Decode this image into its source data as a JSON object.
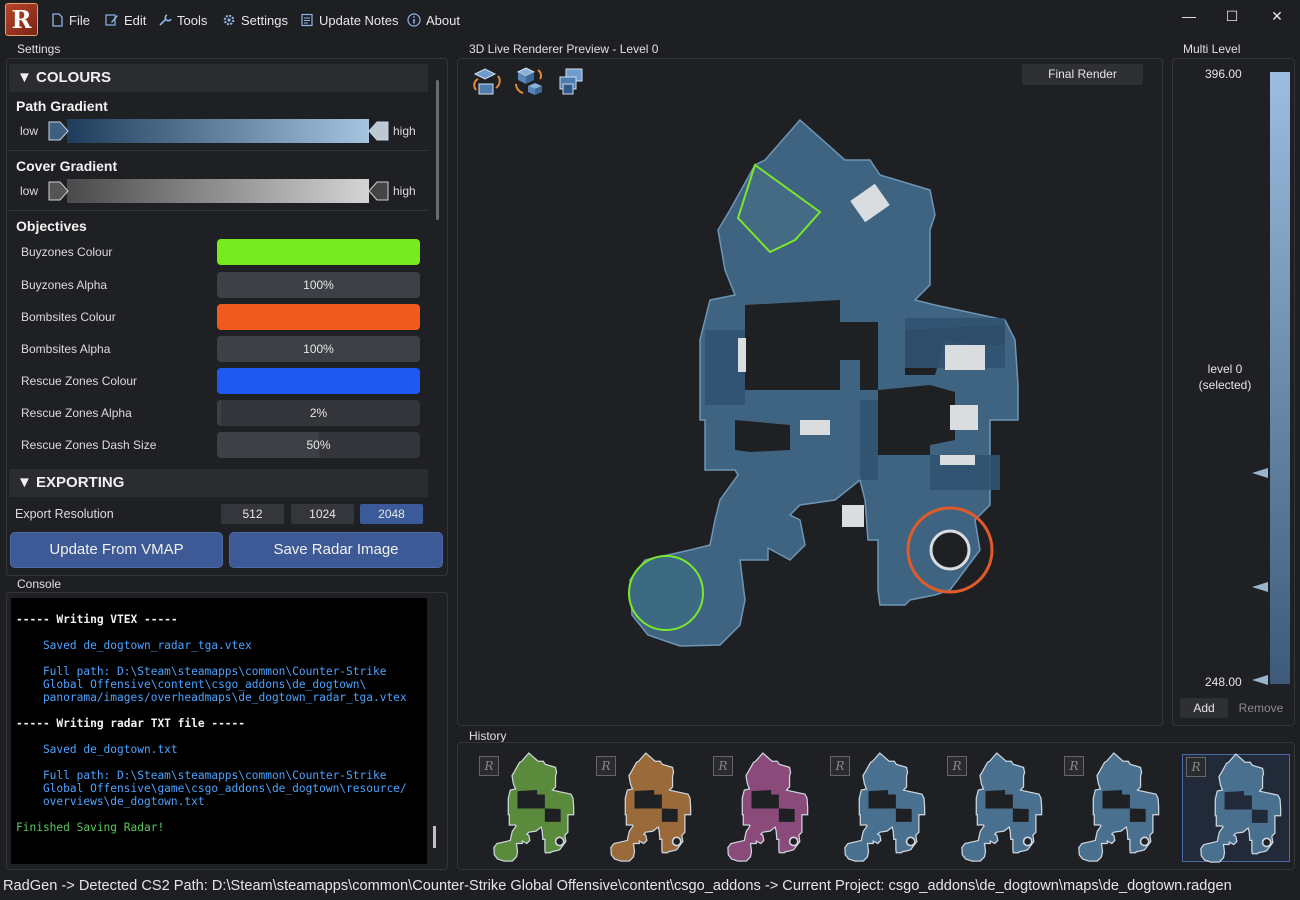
{
  "app": {
    "logo_letter": "R"
  },
  "menu": [
    {
      "label": "File",
      "icon": "file-icon"
    },
    {
      "label": "Edit",
      "icon": "edit-icon"
    },
    {
      "label": "Tools",
      "icon": "tools-icon"
    },
    {
      "label": "Settings",
      "icon": "gear-icon"
    },
    {
      "label": "Update Notes",
      "icon": "notes-icon"
    },
    {
      "label": "About",
      "icon": "info-icon"
    }
  ],
  "window_controls": {
    "minimize": "—",
    "maximize": "☐",
    "close": "✕"
  },
  "settings": {
    "title": "Settings",
    "colours": {
      "header": "▼ COLOURS",
      "path_gradient": {
        "title": "Path Gradient",
        "low": "low",
        "high": "high",
        "from": "#1e3d5c",
        "to": "#a6c4e0"
      },
      "cover_gradient": {
        "title": "Cover Gradient",
        "low": "low",
        "high": "high",
        "from": "#4a4a4a",
        "to": "#d4d4d4"
      },
      "objectives_title": "Objectives",
      "objectives": [
        {
          "label": "Buyzones Colour",
          "type": "color",
          "color": "#76ea1e"
        },
        {
          "label": "Buyzones Alpha",
          "type": "slider",
          "value": "100%",
          "fraction": 1.0
        },
        {
          "label": "Bombsites Colour",
          "type": "color",
          "color": "#f05a1e"
        },
        {
          "label": "Bombsites Alpha",
          "type": "slider",
          "value": "100%",
          "fraction": 1.0
        },
        {
          "label": "Rescue Zones Colour",
          "type": "color",
          "color": "#1e5af0"
        },
        {
          "label": "Rescue Zones Alpha",
          "type": "slider",
          "value": "2%",
          "fraction": 0.02
        },
        {
          "label": "Rescue Zones Dash Size",
          "type": "slider",
          "value": "50%",
          "fraction": 0.5
        }
      ]
    },
    "exporting": {
      "header": "▼ EXPORTING",
      "resolution_label": "Export Resolution",
      "resolutions": [
        "512",
        "1024",
        "2048"
      ],
      "selected_resolution": "2048"
    },
    "update_button": "Update From VMAP",
    "save_button": "Save Radar Image"
  },
  "console": {
    "title": "Console",
    "lines": [
      {
        "text": "----- Writing VTEX -----",
        "style": "white"
      },
      {
        "text": "",
        "style": "gap"
      },
      {
        "text": "    Saved de_dogtown_radar_tga.vtex",
        "style": "blue"
      },
      {
        "text": "",
        "style": "gap"
      },
      {
        "text": "    Full path: D:\\Steam\\steamapps\\common\\Counter-Strike",
        "style": "blue"
      },
      {
        "text": "    Global Offensive\\content\\csgo_addons\\de_dogtown\\",
        "style": "blue"
      },
      {
        "text": "    panorama/images/overheadmaps\\de_dogtown_radar_tga.vtex",
        "style": "blue"
      },
      {
        "text": "",
        "style": "gap"
      },
      {
        "text": "----- Writing radar TXT file -----",
        "style": "white"
      },
      {
        "text": "",
        "style": "gap"
      },
      {
        "text": "    Saved de_dogtown.txt",
        "style": "blue"
      },
      {
        "text": "",
        "style": "gap"
      },
      {
        "text": "    Full path: D:\\Steam\\steamapps\\common\\Counter-Strike",
        "style": "blue"
      },
      {
        "text": "    Global Offensive\\game\\csgo_addons\\de_dogtown\\resource/",
        "style": "blue"
      },
      {
        "text": "    overviews\\de_dogtown.txt",
        "style": "blue"
      },
      {
        "text": "",
        "style": "gap"
      },
      {
        "text": "Finished Saving Radar!",
        "style": "green"
      }
    ]
  },
  "preview": {
    "title": "3D Live Renderer Preview - Level 0",
    "mode_button": "Final Render"
  },
  "multi_level": {
    "title": "Multi Level",
    "top_value": "396.00",
    "bottom_value": "248.00",
    "level_name": "level 0",
    "level_state": "(selected)",
    "add_button": "Add",
    "remove_button": "Remove"
  },
  "history": {
    "title": "History",
    "badge": "R",
    "thumbnails": [
      {
        "color": "#5a8a3c",
        "selected": false
      },
      {
        "color": "#9a6a3a",
        "selected": false
      },
      {
        "color": "#8a4a7a",
        "selected": false
      },
      {
        "color": "#4a7090",
        "selected": false
      },
      {
        "color": "#4a7090",
        "selected": false
      },
      {
        "color": "#4a7090",
        "selected": false
      },
      {
        "color": "#4a7090",
        "selected": true
      }
    ]
  },
  "statusbar": {
    "text": "RadGen  ->  Detected CS2 Path: D:\\Steam\\steamapps\\common\\Counter-Strike Global Offensive\\content\\csgo_addons  ->  Current Project: csgo_addons\\de_dogtown\\maps\\de_dogtown.radgen"
  }
}
